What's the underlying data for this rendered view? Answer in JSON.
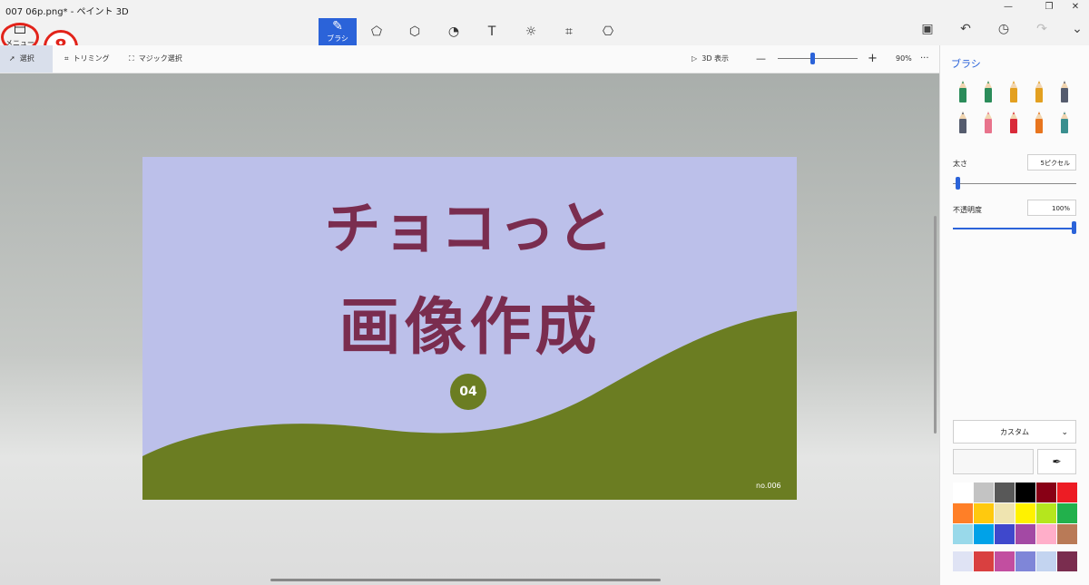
{
  "window": {
    "title": "007 06p.png* - ペイント 3D",
    "controls": [
      "minimize-icon",
      "restore-icon",
      "close-icon"
    ]
  },
  "menu": {
    "label": "メニュー",
    "step_badge": "8"
  },
  "top_tools": [
    {
      "name": "brush",
      "icon": "brush-icon",
      "label": "ブラシ",
      "active": true
    },
    {
      "name": "2d-shapes",
      "icon": "shapes-2d-icon"
    },
    {
      "name": "3d-shapes",
      "icon": "cube-icon"
    },
    {
      "name": "stickers",
      "icon": "sticker-icon"
    },
    {
      "name": "text",
      "icon": "text-icon"
    },
    {
      "name": "effects",
      "icon": "effects-icon"
    },
    {
      "name": "canvas",
      "icon": "crop-canvas-icon"
    },
    {
      "name": "3d-library",
      "icon": "library-icon"
    }
  ],
  "right_tools": [
    "paste-icon",
    "undo-icon",
    "history-icon",
    "redo-icon",
    "expand-icon"
  ],
  "subbar": {
    "select": "選択",
    "trim": "トリミング",
    "magic_select": "マジック選択",
    "view3d": "3D 表示",
    "zoom_minus": "—",
    "zoom_plus": "+",
    "zoom": "90%",
    "more": "···"
  },
  "canvas_image": {
    "title_line1": "チョコっと",
    "title_line2": "画像作成",
    "number": "04",
    "code": "no.006",
    "colors": {
      "bg": "#bcc0ea",
      "hill": "#6b7d22",
      "text": "#7a2d4f"
    }
  },
  "panel": {
    "title": "ブラシ",
    "brushes": [
      {
        "icon": "marker-icon",
        "color": "#2b8c5a"
      },
      {
        "icon": "calligraphy-pen-icon",
        "color": "#2b8c5a"
      },
      {
        "icon": "oil-brush-icon",
        "color": "#e3a020"
      },
      {
        "icon": "watercolor-icon",
        "color": "#e3a020"
      },
      {
        "icon": "pixel-pen-icon",
        "color": "#555c6e"
      },
      {
        "icon": "pencil-icon",
        "color": "#555c6e"
      },
      {
        "icon": "eraser-icon",
        "color": "#e8738c"
      },
      {
        "icon": "crayon-icon",
        "color": "#d92b3a"
      },
      {
        "icon": "spray-can-icon",
        "color": "#e8751e"
      },
      {
        "icon": "fill-bucket-icon",
        "color": "#3a8f8f"
      }
    ],
    "thickness_label": "太さ",
    "thickness_value": "5ピクセル",
    "thickness_level": 0.05,
    "opacity_label": "不透明度",
    "opacity_value": "100%",
    "opacity_level": 1.0,
    "color_mode": "カスタム",
    "picker_icon": "eyedropper-icon",
    "palette": [
      "#ffffff",
      "#c3c3c3",
      "#585858",
      "#000000",
      "#880015",
      "#ed1c24",
      "#ff7f27",
      "#ffc90e",
      "#efe4b0",
      "#fff200",
      "#b5e61d",
      "#22b14c",
      "#99d9ea",
      "#00a2e8",
      "#3f48cc",
      "#a349a4",
      "#ffaec9",
      "#b97a57"
    ],
    "custom_colors": [
      "#dfe3f4",
      "#d94040",
      "#c24ea0",
      "#7f86d8",
      "#c3d4f0",
      "#7a2d4f"
    ]
  }
}
